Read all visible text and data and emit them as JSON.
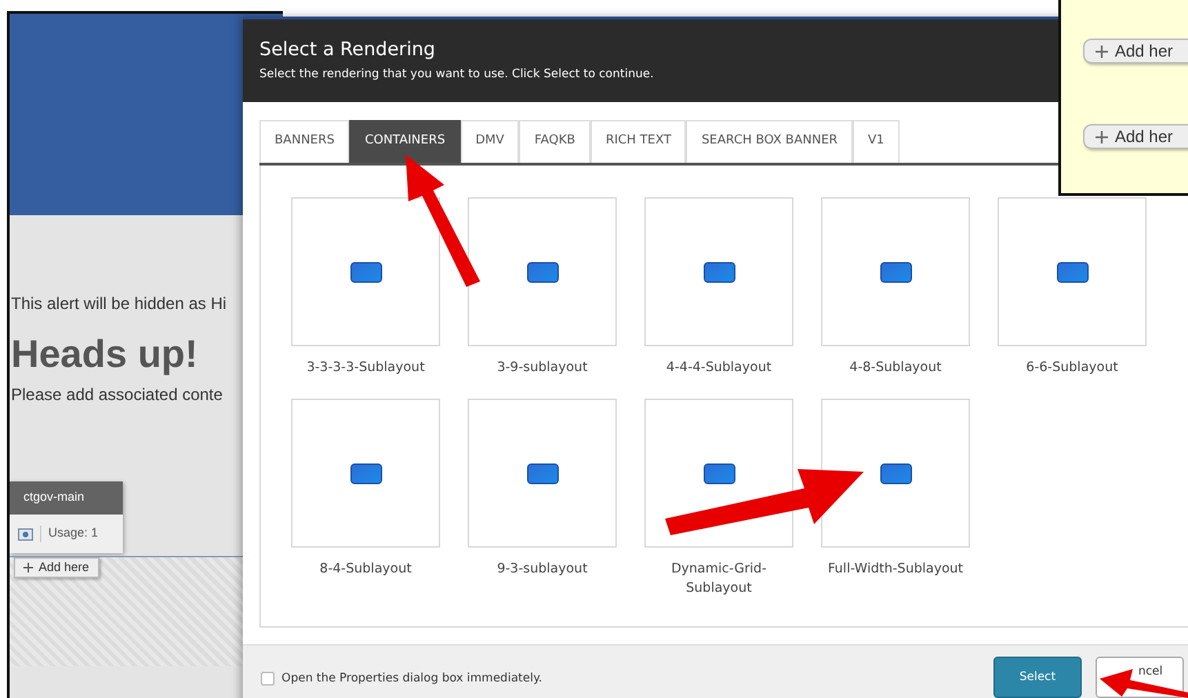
{
  "page": {
    "alert_text": "This alert will be hidden as Hi",
    "heading": "Heads up!",
    "body_text": "Please add associated conte",
    "placeholder_panel": {
      "title": "ctgov-main",
      "usage": "Usage: 1",
      "add_button": "Add here"
    }
  },
  "popup": {
    "add_buttons": [
      "Add her",
      "Add her"
    ]
  },
  "dialog": {
    "title": "Select a Rendering",
    "subtitle": "Select the rendering that you want to use. Click Select to continue.",
    "tabs": [
      {
        "label": "BANNERS",
        "selected": false
      },
      {
        "label": "CONTAINERS",
        "selected": true
      },
      {
        "label": "DMV",
        "selected": false
      },
      {
        "label": "FAQKB",
        "selected": false
      },
      {
        "label": "RICH TEXT",
        "selected": false
      },
      {
        "label": "SEARCH BOX BANNER",
        "selected": false
      },
      {
        "label": "V1",
        "selected": false
      }
    ],
    "renderings": [
      "3-3-3-3-Sublayout",
      "3-9-sublayout",
      "4-4-4-Sublayout",
      "4-8-Sublayout",
      "6-6-Sublayout",
      "8-4-Sublayout",
      "9-3-sublayout",
      "Dynamic-Grid-Sublayout",
      "Full-Width-Sublayout"
    ],
    "open_properties": {
      "label": "Open the Properties dialog box immediately.",
      "checked": false
    },
    "buttons": [
      "Select",
      "ncel"
    ]
  }
}
